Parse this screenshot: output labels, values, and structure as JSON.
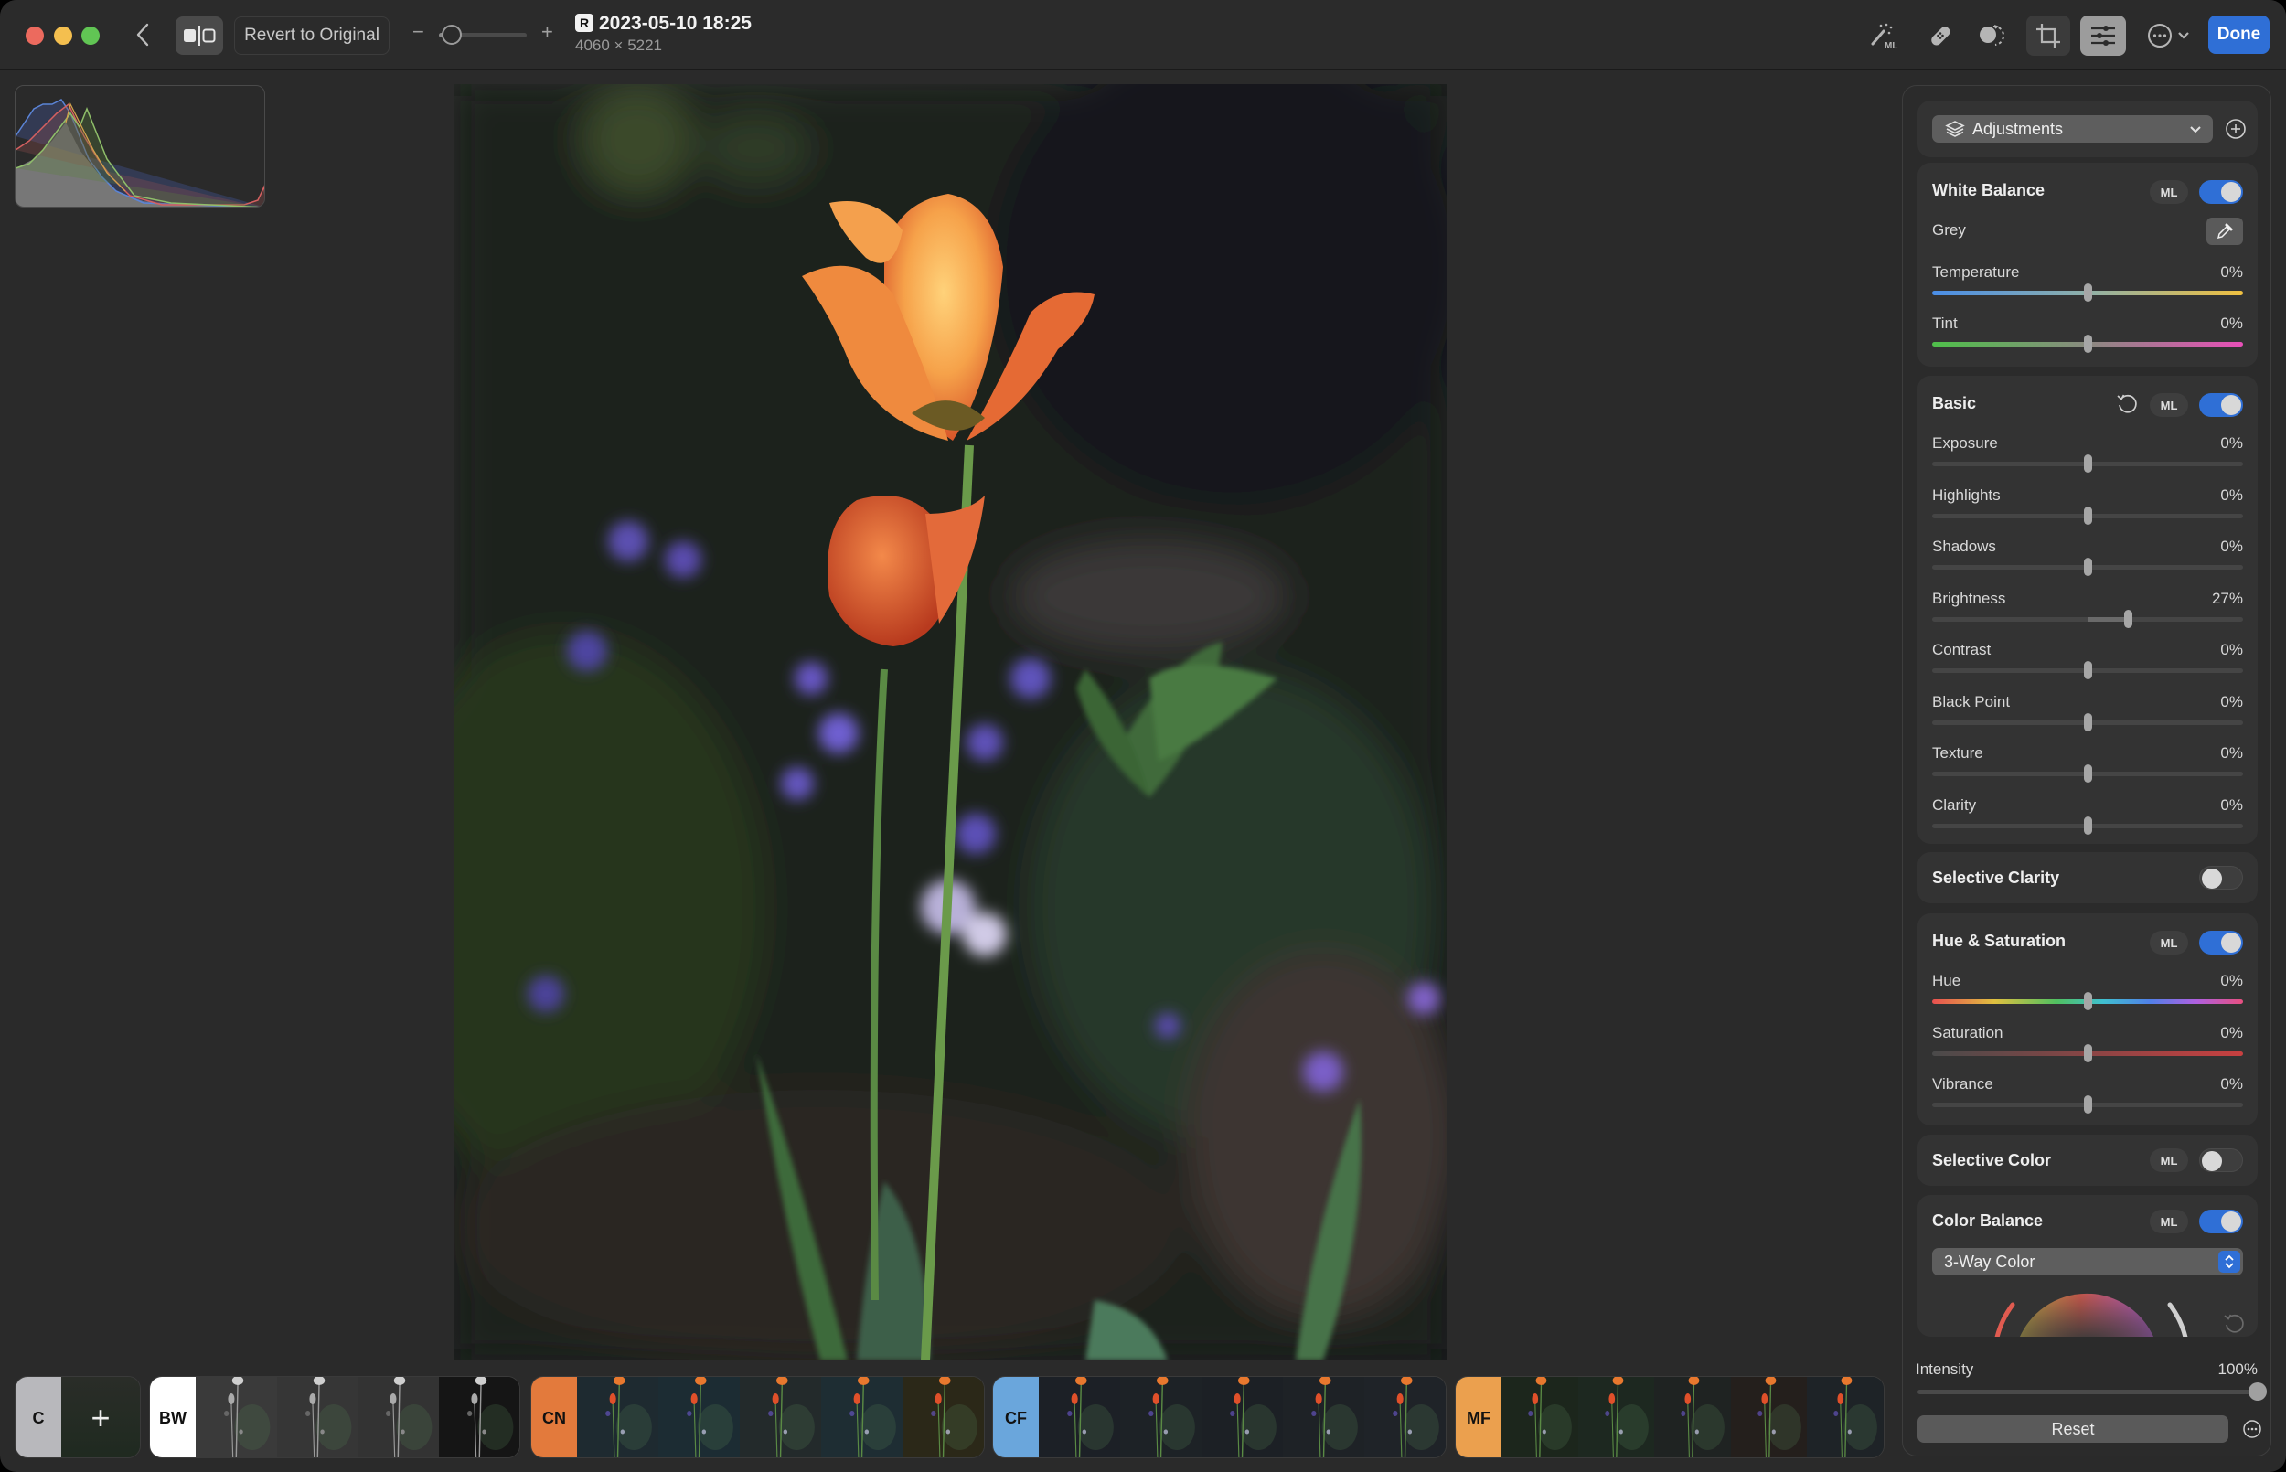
{
  "toolbar": {
    "revert_label": "Revert to Original",
    "zoom_minus": "−",
    "zoom_plus": "+",
    "zoom_level": 0.15,
    "raw_badge": "R",
    "title": "2023-05-10 18:25",
    "dimensions": "4060 × 5221",
    "done_label": "Done",
    "tools": [
      {
        "name": "ml-magic-wand",
        "active": false
      },
      {
        "name": "heal-bandage",
        "active": false
      },
      {
        "name": "mask",
        "active": false
      },
      {
        "name": "crop",
        "active": false
      },
      {
        "name": "adjustments",
        "active": true
      },
      {
        "name": "more-options",
        "active": false
      }
    ]
  },
  "photo": {
    "description": "Orange tulip on green stem with a second red tulip behind, blurred garden background with purple flowers"
  },
  "filmstrip": {
    "groups": [
      {
        "tag": "C",
        "color": "#b8b8bc",
        "thumbs": 1,
        "style": "add"
      },
      {
        "tag": "BW",
        "color": "#ffffff",
        "thumbs": 4,
        "style": "bw"
      },
      {
        "tag": "CN",
        "color": "#e37a3c",
        "thumbs": 5,
        "style": "cn"
      },
      {
        "tag": "CF",
        "color": "#6aa6dc",
        "thumbs": 5,
        "style": "cf"
      },
      {
        "tag": "MF",
        "color": "#eba04e",
        "thumbs": 5,
        "style": "mf"
      }
    ],
    "add_symbol": "+"
  },
  "panel": {
    "layer_select": "Adjustments",
    "white_balance": {
      "title": "White Balance",
      "ml": "ML",
      "enabled": true,
      "grey_label": "Grey",
      "sliders": [
        {
          "label": "Temperature",
          "value": "0%",
          "position": 0.5
        },
        {
          "label": "Tint",
          "value": "0%",
          "position": 0.5
        }
      ]
    },
    "basic": {
      "title": "Basic",
      "ml": "ML",
      "enabled": true,
      "sliders": [
        {
          "label": "Exposure",
          "value": "0%",
          "position": 0.5
        },
        {
          "label": "Highlights",
          "value": "0%",
          "position": 0.5
        },
        {
          "label": "Shadows",
          "value": "0%",
          "position": 0.5
        },
        {
          "label": "Brightness",
          "value": "27%",
          "position": 0.63
        },
        {
          "label": "Contrast",
          "value": "0%",
          "position": 0.5
        },
        {
          "label": "Black Point",
          "value": "0%",
          "position": 0.5
        },
        {
          "label": "Texture",
          "value": "0%",
          "position": 0.5
        },
        {
          "label": "Clarity",
          "value": "0%",
          "position": 0.5
        }
      ]
    },
    "selective_clarity": {
      "title": "Selective Clarity",
      "enabled": false
    },
    "hue_saturation": {
      "title": "Hue & Saturation",
      "ml": "ML",
      "enabled": true,
      "sliders": [
        {
          "label": "Hue",
          "value": "0%",
          "position": 0.5
        },
        {
          "label": "Saturation",
          "value": "0%",
          "position": 0.5
        },
        {
          "label": "Vibrance",
          "value": "0%",
          "position": 0.5
        }
      ]
    },
    "selective_color": {
      "title": "Selective Color",
      "ml": "ML",
      "enabled": false
    },
    "color_balance": {
      "title": "Color Balance",
      "ml": "ML",
      "enabled": true,
      "mode": "3-Way Color"
    },
    "intensity": {
      "label": "Intensity",
      "value": "100%",
      "position": 1.0
    },
    "reset_label": "Reset"
  },
  "colors": {
    "accent": "#2f6fd6",
    "window_bg": "#2a2a2a",
    "card_bg": "#333333"
  }
}
